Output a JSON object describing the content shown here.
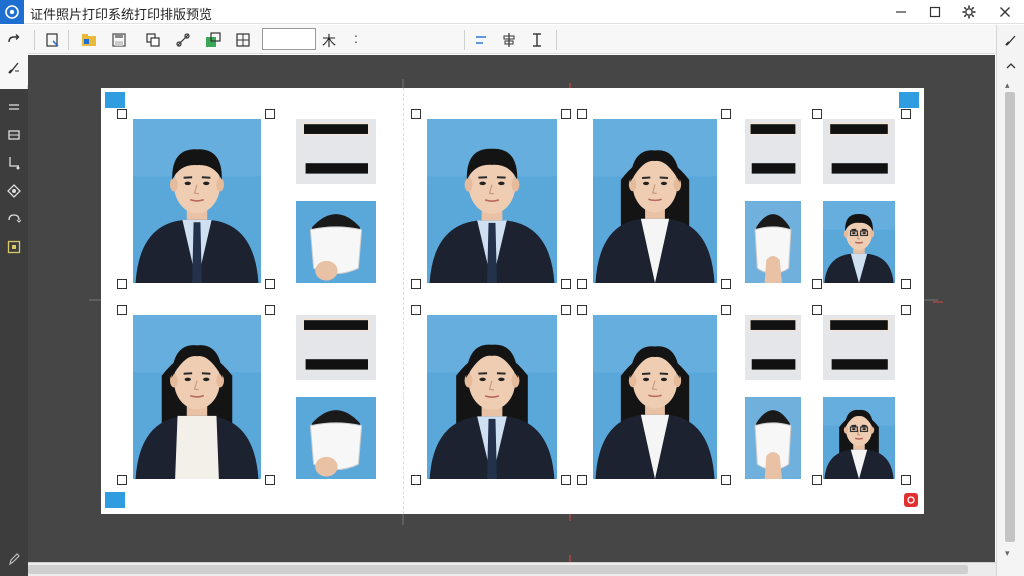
{
  "window": {
    "title": "证件照片打印系统打印排版预览",
    "controls": [
      "minimize",
      "maximize",
      "settings",
      "close"
    ]
  },
  "toolbar": {
    "size_value": "",
    "font_glyph": "木",
    "more": ":"
  },
  "colors": {
    "accent": "#2f9de0",
    "canvas_bg": "#464646",
    "photo_bg": "#5aa7da",
    "alert": "#e03030"
  },
  "layout": {
    "photos": [
      {
        "type": "portrait",
        "gender": "male",
        "tie": true
      },
      {
        "type": "portrait",
        "gender": "male",
        "tie": true
      },
      {
        "type": "portrait",
        "gender": "female",
        "tie": false
      },
      {
        "type": "portrait",
        "gender": "female",
        "sweater": true
      },
      {
        "type": "portrait",
        "gender": "male",
        "long_hair": true,
        "tie": true
      },
      {
        "type": "portrait",
        "gender": "female",
        "tie": false
      }
    ],
    "small_photos": [
      {
        "type": "censored"
      },
      {
        "type": "hair-cloth"
      },
      {
        "type": "hair-cloth-hand"
      },
      {
        "type": "censored"
      },
      {
        "type": "small-male",
        "glasses": true
      },
      {
        "type": "censored"
      },
      {
        "type": "hair-cloth"
      },
      {
        "type": "censored"
      },
      {
        "type": "censored"
      },
      {
        "type": "hair-cloth-hand"
      },
      {
        "type": "small-female",
        "glasses": true
      }
    ]
  }
}
